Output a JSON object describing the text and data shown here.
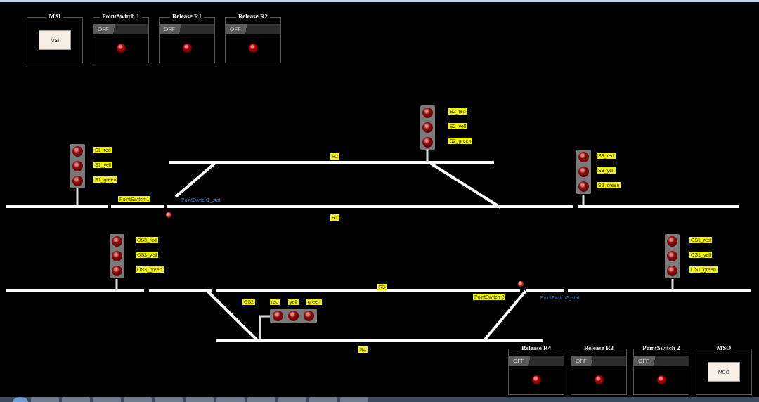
{
  "top_panels": [
    {
      "kind": "button",
      "title": "MSI",
      "button": "MSI"
    },
    {
      "kind": "toggle",
      "title": "PointSwitch 1",
      "toggle": {
        "label": "OFF",
        "on": false
      },
      "lamp_lit": false
    },
    {
      "kind": "toggle",
      "title": "Release R1",
      "toggle": {
        "label": "OFF",
        "on": false
      },
      "lamp_lit": false
    },
    {
      "kind": "toggle",
      "title": "Release R2",
      "toggle": {
        "label": "OFF",
        "on": false
      },
      "lamp_lit": false
    }
  ],
  "tracks": [
    {
      "label": "R2"
    },
    {
      "label": "R1"
    },
    {
      "label": "R3"
    },
    {
      "label": "R4"
    }
  ],
  "signals": [
    {
      "lamps": [
        {
          "label": "S1_red",
          "lit": false
        },
        {
          "label": "S1_yell",
          "lit": false
        },
        {
          "label": "S1_green",
          "lit": false
        }
      ]
    },
    {
      "lamps": [
        {
          "label": "S2_red",
          "lit": false
        },
        {
          "label": "S2_yell",
          "lit": false
        },
        {
          "label": "S2_green",
          "lit": false
        }
      ]
    },
    {
      "lamps": [
        {
          "label": "S3_red",
          "lit": false
        },
        {
          "label": "S3_yell",
          "lit": false
        },
        {
          "label": "S3_green",
          "lit": false
        }
      ]
    },
    {
      "lamps": [
        {
          "label": "OS3_red",
          "lit": false
        },
        {
          "label": "OS3_yell",
          "lit": false
        },
        {
          "label": "OS3_green",
          "lit": false
        }
      ]
    },
    {
      "lamps": [
        {
          "label": "OS1_red",
          "lit": false
        },
        {
          "label": "OS1_yell",
          "lit": false
        },
        {
          "label": "OS1_green",
          "lit": false
        }
      ]
    }
  ],
  "side_signal": {
    "label": "OS2",
    "lamps": [
      {
        "label": "red",
        "lit": false
      },
      {
        "label": "yell",
        "lit": false
      },
      {
        "label": "green",
        "lit": false
      }
    ]
  },
  "point_switches": [
    {
      "label": "PointSwitch 1",
      "status": "PointSwitch1_stat",
      "lamp_lit": false
    },
    {
      "label": "PointSwitch 2",
      "status": "PointSwitch2_stat",
      "lamp_lit": false
    }
  ],
  "bottom_panels": [
    {
      "kind": "toggle",
      "title": "Release R4",
      "toggle": {
        "label": "OFF",
        "on": false
      },
      "lamp_lit": false
    },
    {
      "kind": "toggle",
      "title": "Release R3",
      "toggle": {
        "label": "OFF",
        "on": false
      },
      "lamp_lit": false
    },
    {
      "kind": "toggle",
      "title": "PointSwitch 2",
      "toggle": {
        "label": "OFF",
        "on": false
      },
      "lamp_lit": false
    },
    {
      "kind": "button",
      "title": "MSO",
      "button": "MSO"
    }
  ]
}
